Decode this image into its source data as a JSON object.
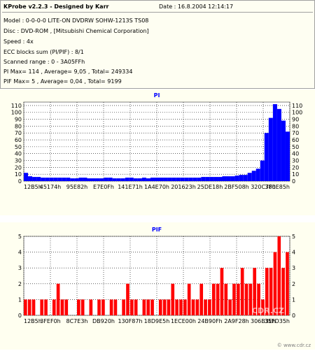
{
  "info": {
    "title": "KProbe v2.2.3 - Designed by Karr",
    "date": "Date : 16.8.2004 12:14:17",
    "lines": [
      "Model : 0-0-0-0 LITE-ON DVDRW SOHW-1213S TS08",
      "Disc : DVD-ROM , [Mitsubishi Chemical Corporation]",
      "Speed : 4x",
      "ECC blocks sum (PI/PIF) : 8/1",
      "Scanned range : 0 - 3A05FFh",
      "PI Max= 114 , Average= 9,05 , Total= 249334",
      "PIF Max= 5 , Average= 0,04 , Total= 9199"
    ]
  },
  "colors": {
    "series": "#0000ff",
    "pif_series": "#ff0000",
    "title": "#0000ff",
    "grid": "#000000"
  },
  "watermark": "CDR.CZ",
  "footer": "© www.cdr.cz",
  "chart_data": [
    {
      "type": "area",
      "title": "PI",
      "xlabel": "",
      "ylabel": "",
      "ylim": [
        0,
        115
      ],
      "yticks": [
        0,
        10,
        20,
        30,
        40,
        50,
        60,
        70,
        80,
        90,
        100,
        110
      ],
      "xticks": [
        "12B5h",
        "45174h",
        "95E82h",
        "E7E0Fh",
        "141E71h",
        "1A4E70h",
        "201623h",
        "25DE18h",
        "2BF508h",
        "320C7Fh",
        "380E85h"
      ],
      "grid": true,
      "series": [
        {
          "values": [
            12,
            7,
            6,
            6,
            5,
            5,
            5,
            5,
            5,
            5,
            5,
            4,
            4,
            5,
            5,
            4,
            4,
            4,
            4,
            5,
            5,
            4,
            4,
            4,
            5,
            5,
            4,
            4,
            5,
            4,
            5,
            5,
            5,
            5,
            5,
            5,
            5,
            5,
            5,
            5,
            5,
            5,
            6,
            6,
            6,
            6,
            6,
            7,
            7,
            7,
            8,
            9,
            9,
            12,
            15,
            18,
            30,
            70,
            92,
            112,
            105,
            88,
            72
          ]
        }
      ]
    },
    {
      "type": "bar",
      "title": "PIF",
      "xlabel": "",
      "ylabel": "",
      "ylim": [
        0,
        5
      ],
      "yticks": [
        0,
        1,
        2,
        3,
        4,
        5
      ],
      "xticks": [
        "12B5h",
        "3FEF0h",
        "8C7E3h",
        "DB920h",
        "130F87h",
        "18D9E5h",
        "1ECE00h",
        "24B90Fh",
        "2A9F28h",
        "306B3Eh",
        "35FD35h"
      ],
      "grid": true,
      "series": [
        {
          "values": [
            1,
            1,
            1,
            0,
            1,
            1,
            0,
            1,
            2,
            1,
            1,
            0,
            0,
            1,
            1,
            0,
            1,
            0,
            1,
            1,
            0,
            1,
            1,
            0,
            1,
            2,
            1,
            1,
            0,
            1,
            1,
            1,
            0,
            1,
            1,
            1,
            2,
            1,
            1,
            1,
            2,
            1,
            1,
            2,
            1,
            1,
            2,
            2,
            3,
            2,
            1,
            2,
            2,
            3,
            2,
            2,
            3,
            2,
            1,
            3,
            3,
            4,
            5,
            3,
            4
          ]
        }
      ]
    }
  ]
}
